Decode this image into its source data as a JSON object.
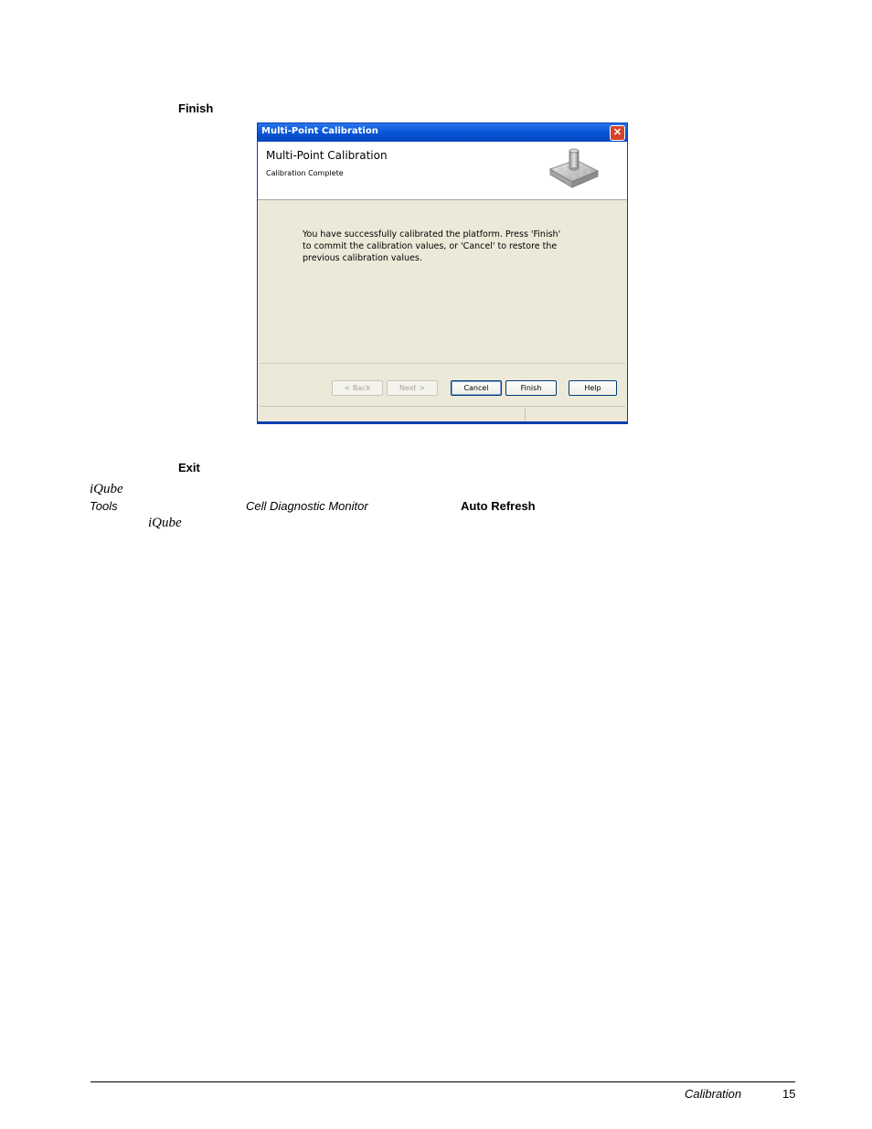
{
  "doc": {
    "finish_word": "Finish",
    "exit_word": "Exit",
    "iqube_1": "iQube",
    "tools": "Tools",
    "cell_diag": "Cell Diagnostic Monitor",
    "auto_refresh": "Auto Refresh",
    "iqube_2": "iQube"
  },
  "dialog": {
    "window_title": "Multi-Point Calibration",
    "close_glyph": "✕",
    "header_title": "Multi-Point Calibration",
    "header_subtitle": "Calibration Complete",
    "message_line1": "You have successfully calibrated the platform. Press 'Finish'",
    "message_line2": "to commit the calibration values, or 'Cancel' to restore the",
    "message_line3": "previous calibration values.",
    "buttons": {
      "back": "< Back",
      "next": "Next >",
      "cancel": "Cancel",
      "finish": "Finish",
      "help": "Help"
    },
    "icon": "platform-icon"
  },
  "footer": {
    "section": "Calibration",
    "page": "15"
  },
  "colors": {
    "titlebar": "#0a58d8",
    "dialog_bg": "#ece9d8",
    "close_btn": "#d6442c"
  }
}
